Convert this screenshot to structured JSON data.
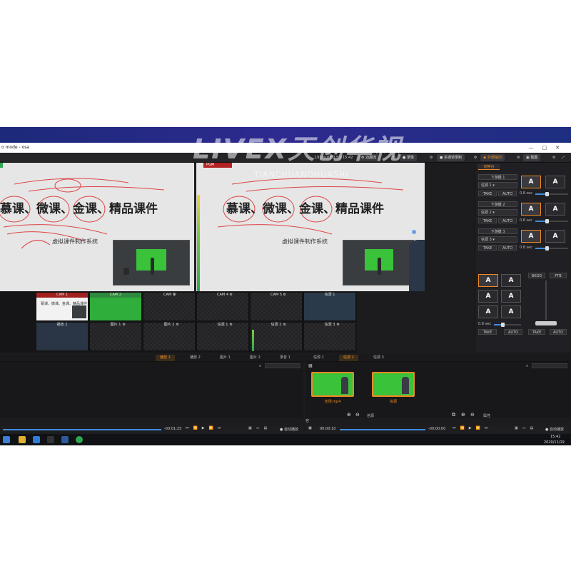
{
  "window": {
    "title": "o mode - osa",
    "controls": [
      "—",
      "□",
      "✕"
    ]
  },
  "toolbar": {
    "resolution": "1920x1080 50i",
    "time": "15:42",
    "btn_virtual": "迈翻流",
    "btn_record": "录像",
    "btn_multi": "多通道录制",
    "btn_output": "外部输出",
    "btn_screenshot": "截图"
  },
  "preview": {
    "title_text": "慕课、微课、金课、精品课件",
    "subtitle": "虚拟课件制作系统",
    "pgm_label": "PGM"
  },
  "right_panel": {
    "tab": "切换台",
    "dsk": [
      {
        "label": "下游键 1",
        "select": "信源 1",
        "take": "TAKE",
        "auto": "AUTO",
        "rate": "0.8 sec",
        "a1": "A",
        "a2": "A"
      },
      {
        "label": "下游键 2",
        "select": "信源 2",
        "take": "TAKE",
        "auto": "AUTO",
        "rate": "0.8 sec",
        "a1": "A",
        "a2": "A"
      },
      {
        "label": "下游键 3",
        "select": "信源 3",
        "take": "TAKE",
        "auto": "AUTO",
        "rate": "0.8 sec",
        "a1": "A",
        "a2": "A"
      }
    ],
    "grid_buttons": [
      "A",
      "A",
      "A",
      "A",
      "A",
      "A"
    ],
    "bkgd": "BKGD",
    "ftb": "FTB",
    "rate": "0.8 sec",
    "take1": "TAKE",
    "auto1": "AUTO",
    "take2": "TAKE",
    "auto2": "AUTO"
  },
  "sources": [
    {
      "label": "CAM 1",
      "style": "red"
    },
    {
      "label": "CAM 2",
      "style": "green"
    },
    {
      "label": "CAM 3",
      "style": ""
    },
    {
      "label": "CAM 4",
      "style": ""
    },
    {
      "label": "CAM 5",
      "style": ""
    },
    {
      "label": "信源 1",
      "style": ""
    },
    {
      "label": "播放 2",
      "style": ""
    },
    {
      "label": "图片 1",
      "style": ""
    },
    {
      "label": "图片 2",
      "style": ""
    },
    {
      "label": "信源 1",
      "style": ""
    },
    {
      "label": "信源 2",
      "style": ""
    },
    {
      "label": "信源 3",
      "style": ""
    }
  ],
  "tabs_left": [
    "播放 1",
    "播放 2",
    "图片 1",
    "图片 2",
    "录音 1",
    "信源 1",
    "信源 2",
    "信源 3"
  ],
  "media": [
    {
      "label": "全场.mp4"
    },
    {
      "label": "信源"
    }
  ],
  "lower_labels": {
    "left": "内容",
    "middle": "信源",
    "right": "属性"
  },
  "transport": {
    "left_time": "-00:01:25",
    "mid_start": "00:00:10",
    "mid_end": "-00:00:00",
    "auto_play_left": "自动播放",
    "auto_play_right": "自动播放"
  },
  "taskbar": {
    "time": "15:42",
    "date": "2020/11/19"
  },
  "watermark": {
    "big": "LIVEX天创华视",
    "small": "TIANCHUANGHUASHI"
  }
}
